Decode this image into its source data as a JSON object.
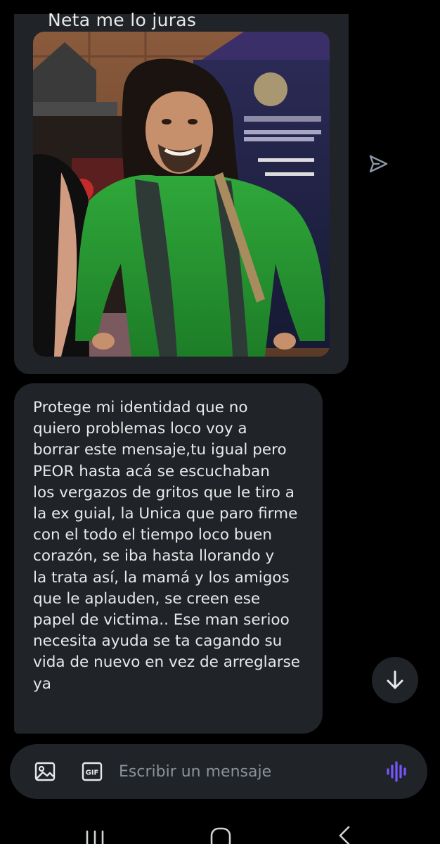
{
  "conversation": {
    "messages": [
      {
        "caption": "Neta me lo juras",
        "image_alt": "Foto de un hombre con cabello largo y suéter verde"
      },
      {
        "text": "Protege mi identidad que no\nquiero problemas loco voy a\nborrar este mensaje,tu igual pero\nPEOR hasta acá se escuchaban\nlos vergazos de gritos que le tiro a\nla ex guial, la Unica que paro firme\ncon el todo el tiempo loco buen\ncorazón, se iba hasta llorando y\nla trata así, la mamá y los amigos\nque le aplauden, se creen ese\npapel de victima.. Ese man serioo\nnecesita ayuda se ta cagando su\nvida de nuevo en vez de arreglarse\nya"
      }
    ]
  },
  "composer": {
    "placeholder": "Escribir un mensaje"
  },
  "icons": {
    "send": "send-icon",
    "scroll_down": "arrow-down-icon",
    "image": "image-icon",
    "gif": "gif-icon",
    "voice": "voice-wave-icon"
  },
  "colors": {
    "background": "#000000",
    "bubble": "#202327",
    "text": "#e7e9ea",
    "placeholder": "#8b9299",
    "accent": "#7856ff"
  }
}
